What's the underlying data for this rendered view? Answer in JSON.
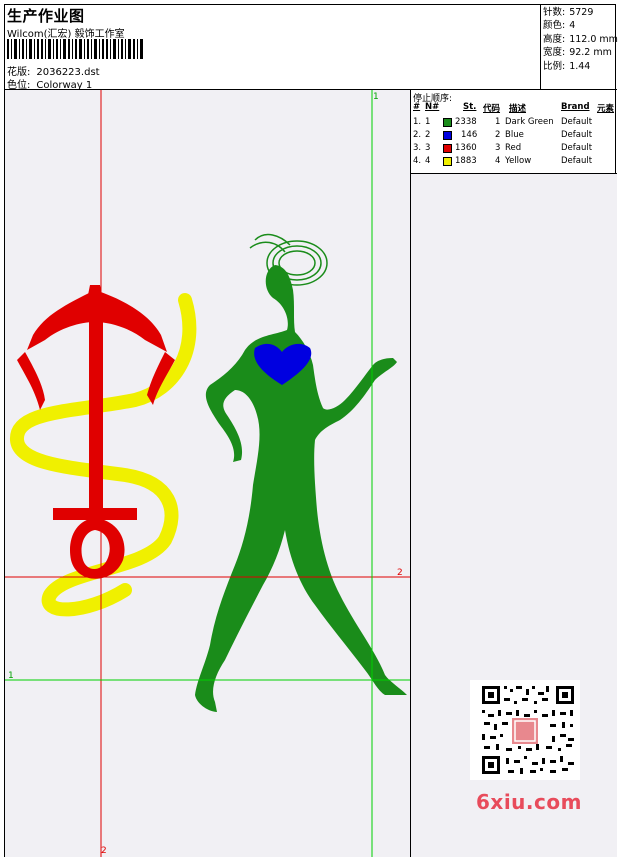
{
  "header": {
    "title": "生产作业图",
    "company": "Wilcom(汇宏) 毅饰工作室",
    "pattern_label": "花版:",
    "pattern_value": "2036223.dst",
    "colorway_label": "色位:",
    "colorway_value": "Colorway 1"
  },
  "stats": [
    {
      "label": "针数:",
      "value": "5729"
    },
    {
      "label": "颜色:",
      "value": "4"
    },
    {
      "label": "高度:",
      "value": "112.0 mm"
    },
    {
      "label": "宽度:",
      "value": "92.2 mm"
    },
    {
      "label": "比例:",
      "value": "1.44"
    }
  ],
  "legend": {
    "title": "停止顺序:",
    "headers": {
      "num": "#",
      "n": "N#",
      "st": "St.",
      "code": "代码",
      "desc": "描述",
      "brand": "Brand",
      "elem": "元素"
    },
    "rows": [
      {
        "num": "1.",
        "n": "1",
        "color": "#1a8c1a",
        "st": "2338",
        "code": "1",
        "desc": "Dark Green",
        "brand": "Default"
      },
      {
        "num": "2.",
        "n": "2",
        "color": "#0000e0",
        "st": "146",
        "code": "2",
        "desc": "Blue",
        "brand": "Default"
      },
      {
        "num": "3.",
        "n": "3",
        "color": "#e00000",
        "st": "1360",
        "code": "3",
        "desc": "Red",
        "brand": "Default"
      },
      {
        "num": "4.",
        "n": "4",
        "color": "#f0f000",
        "st": "1883",
        "code": "4",
        "desc": "Yellow",
        "brand": "Default"
      }
    ]
  },
  "axes": {
    "green_top": "1",
    "green_left": "1",
    "red_right": "2",
    "red_bottom": "2"
  },
  "watermark": "6xiu.com",
  "colors": {
    "green": "#1a8c1a",
    "blue": "#0000e0",
    "red": "#e00000",
    "yellow": "#f0f000",
    "guide_red": "#e00000",
    "guide_green": "#00d000"
  }
}
